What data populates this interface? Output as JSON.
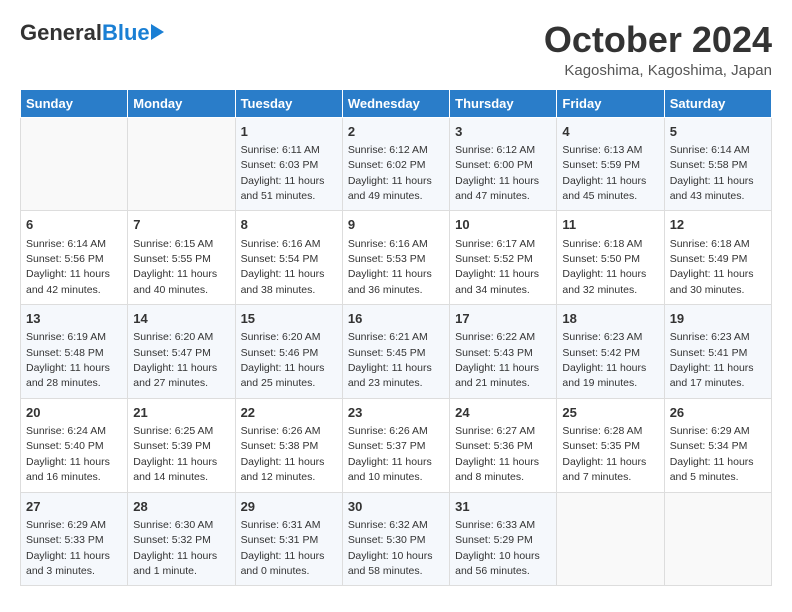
{
  "logo": {
    "general": "General",
    "blue": "Blue"
  },
  "header": {
    "month": "October 2024",
    "location": "Kagoshima, Kagoshima, Japan"
  },
  "weekdays": [
    "Sunday",
    "Monday",
    "Tuesday",
    "Wednesday",
    "Thursday",
    "Friday",
    "Saturday"
  ],
  "weeks": [
    [
      {
        "day": "",
        "sunrise": "",
        "sunset": "",
        "daylight": ""
      },
      {
        "day": "",
        "sunrise": "",
        "sunset": "",
        "daylight": ""
      },
      {
        "day": "1",
        "sunrise": "Sunrise: 6:11 AM",
        "sunset": "Sunset: 6:03 PM",
        "daylight": "Daylight: 11 hours and 51 minutes."
      },
      {
        "day": "2",
        "sunrise": "Sunrise: 6:12 AM",
        "sunset": "Sunset: 6:02 PM",
        "daylight": "Daylight: 11 hours and 49 minutes."
      },
      {
        "day": "3",
        "sunrise": "Sunrise: 6:12 AM",
        "sunset": "Sunset: 6:00 PM",
        "daylight": "Daylight: 11 hours and 47 minutes."
      },
      {
        "day": "4",
        "sunrise": "Sunrise: 6:13 AM",
        "sunset": "Sunset: 5:59 PM",
        "daylight": "Daylight: 11 hours and 45 minutes."
      },
      {
        "day": "5",
        "sunrise": "Sunrise: 6:14 AM",
        "sunset": "Sunset: 5:58 PM",
        "daylight": "Daylight: 11 hours and 43 minutes."
      }
    ],
    [
      {
        "day": "6",
        "sunrise": "Sunrise: 6:14 AM",
        "sunset": "Sunset: 5:56 PM",
        "daylight": "Daylight: 11 hours and 42 minutes."
      },
      {
        "day": "7",
        "sunrise": "Sunrise: 6:15 AM",
        "sunset": "Sunset: 5:55 PM",
        "daylight": "Daylight: 11 hours and 40 minutes."
      },
      {
        "day": "8",
        "sunrise": "Sunrise: 6:16 AM",
        "sunset": "Sunset: 5:54 PM",
        "daylight": "Daylight: 11 hours and 38 minutes."
      },
      {
        "day": "9",
        "sunrise": "Sunrise: 6:16 AM",
        "sunset": "Sunset: 5:53 PM",
        "daylight": "Daylight: 11 hours and 36 minutes."
      },
      {
        "day": "10",
        "sunrise": "Sunrise: 6:17 AM",
        "sunset": "Sunset: 5:52 PM",
        "daylight": "Daylight: 11 hours and 34 minutes."
      },
      {
        "day": "11",
        "sunrise": "Sunrise: 6:18 AM",
        "sunset": "Sunset: 5:50 PM",
        "daylight": "Daylight: 11 hours and 32 minutes."
      },
      {
        "day": "12",
        "sunrise": "Sunrise: 6:18 AM",
        "sunset": "Sunset: 5:49 PM",
        "daylight": "Daylight: 11 hours and 30 minutes."
      }
    ],
    [
      {
        "day": "13",
        "sunrise": "Sunrise: 6:19 AM",
        "sunset": "Sunset: 5:48 PM",
        "daylight": "Daylight: 11 hours and 28 minutes."
      },
      {
        "day": "14",
        "sunrise": "Sunrise: 6:20 AM",
        "sunset": "Sunset: 5:47 PM",
        "daylight": "Daylight: 11 hours and 27 minutes."
      },
      {
        "day": "15",
        "sunrise": "Sunrise: 6:20 AM",
        "sunset": "Sunset: 5:46 PM",
        "daylight": "Daylight: 11 hours and 25 minutes."
      },
      {
        "day": "16",
        "sunrise": "Sunrise: 6:21 AM",
        "sunset": "Sunset: 5:45 PM",
        "daylight": "Daylight: 11 hours and 23 minutes."
      },
      {
        "day": "17",
        "sunrise": "Sunrise: 6:22 AM",
        "sunset": "Sunset: 5:43 PM",
        "daylight": "Daylight: 11 hours and 21 minutes."
      },
      {
        "day": "18",
        "sunrise": "Sunrise: 6:23 AM",
        "sunset": "Sunset: 5:42 PM",
        "daylight": "Daylight: 11 hours and 19 minutes."
      },
      {
        "day": "19",
        "sunrise": "Sunrise: 6:23 AM",
        "sunset": "Sunset: 5:41 PM",
        "daylight": "Daylight: 11 hours and 17 minutes."
      }
    ],
    [
      {
        "day": "20",
        "sunrise": "Sunrise: 6:24 AM",
        "sunset": "Sunset: 5:40 PM",
        "daylight": "Daylight: 11 hours and 16 minutes."
      },
      {
        "day": "21",
        "sunrise": "Sunrise: 6:25 AM",
        "sunset": "Sunset: 5:39 PM",
        "daylight": "Daylight: 11 hours and 14 minutes."
      },
      {
        "day": "22",
        "sunrise": "Sunrise: 6:26 AM",
        "sunset": "Sunset: 5:38 PM",
        "daylight": "Daylight: 11 hours and 12 minutes."
      },
      {
        "day": "23",
        "sunrise": "Sunrise: 6:26 AM",
        "sunset": "Sunset: 5:37 PM",
        "daylight": "Daylight: 11 hours and 10 minutes."
      },
      {
        "day": "24",
        "sunrise": "Sunrise: 6:27 AM",
        "sunset": "Sunset: 5:36 PM",
        "daylight": "Daylight: 11 hours and 8 minutes."
      },
      {
        "day": "25",
        "sunrise": "Sunrise: 6:28 AM",
        "sunset": "Sunset: 5:35 PM",
        "daylight": "Daylight: 11 hours and 7 minutes."
      },
      {
        "day": "26",
        "sunrise": "Sunrise: 6:29 AM",
        "sunset": "Sunset: 5:34 PM",
        "daylight": "Daylight: 11 hours and 5 minutes."
      }
    ],
    [
      {
        "day": "27",
        "sunrise": "Sunrise: 6:29 AM",
        "sunset": "Sunset: 5:33 PM",
        "daylight": "Daylight: 11 hours and 3 minutes."
      },
      {
        "day": "28",
        "sunrise": "Sunrise: 6:30 AM",
        "sunset": "Sunset: 5:32 PM",
        "daylight": "Daylight: 11 hours and 1 minute."
      },
      {
        "day": "29",
        "sunrise": "Sunrise: 6:31 AM",
        "sunset": "Sunset: 5:31 PM",
        "daylight": "Daylight: 11 hours and 0 minutes."
      },
      {
        "day": "30",
        "sunrise": "Sunrise: 6:32 AM",
        "sunset": "Sunset: 5:30 PM",
        "daylight": "Daylight: 10 hours and 58 minutes."
      },
      {
        "day": "31",
        "sunrise": "Sunrise: 6:33 AM",
        "sunset": "Sunset: 5:29 PM",
        "daylight": "Daylight: 10 hours and 56 minutes."
      },
      {
        "day": "",
        "sunrise": "",
        "sunset": "",
        "daylight": ""
      },
      {
        "day": "",
        "sunrise": "",
        "sunset": "",
        "daylight": ""
      }
    ]
  ]
}
